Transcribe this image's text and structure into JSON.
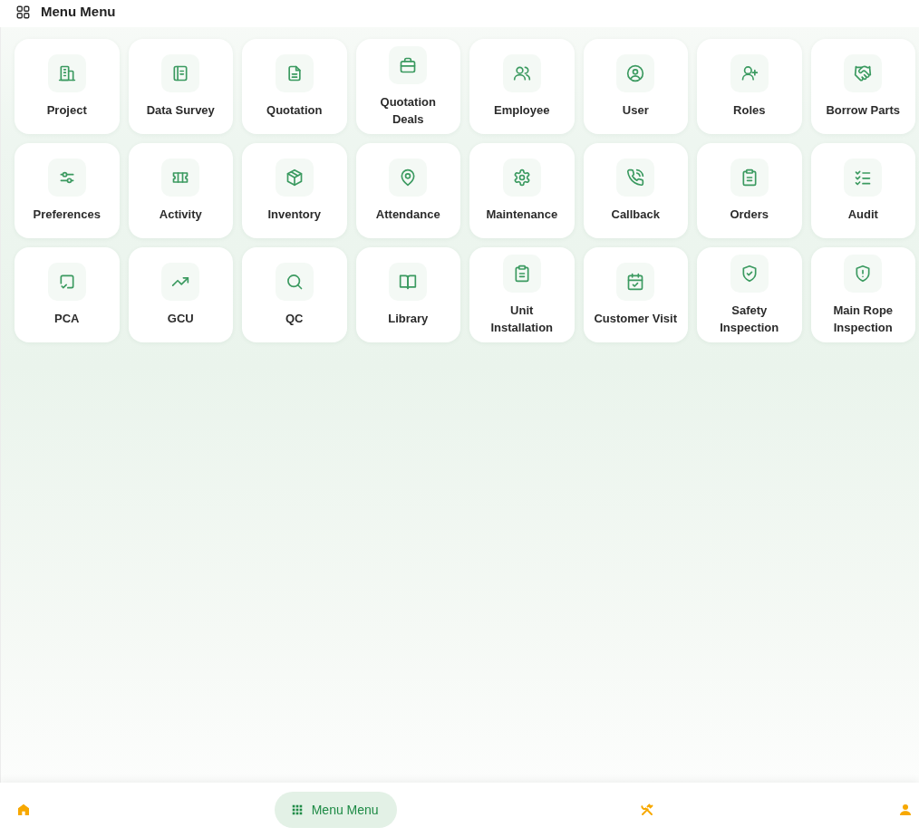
{
  "header": {
    "title": "Menu Menu"
  },
  "menu_items": [
    {
      "label": "Project",
      "kind": "building"
    },
    {
      "label": "Data Survey",
      "kind": "notebook"
    },
    {
      "label": "Quotation",
      "kind": "document"
    },
    {
      "label": "Quotation Deals",
      "kind": "briefcase"
    },
    {
      "label": "Employee",
      "kind": "people"
    },
    {
      "label": "User",
      "kind": "user_circle"
    },
    {
      "label": "Roles",
      "kind": "user_plus"
    },
    {
      "label": "Borrow Parts",
      "kind": "handshake"
    },
    {
      "label": "Preferences",
      "kind": "sliders"
    },
    {
      "label": "Activity",
      "kind": "ticket"
    },
    {
      "label": "Inventory",
      "kind": "package"
    },
    {
      "label": "Attendance",
      "kind": "map_pin"
    },
    {
      "label": "Maintenance",
      "kind": "gear"
    },
    {
      "label": "Callback",
      "kind": "phone_call"
    },
    {
      "label": "Orders",
      "kind": "clipboard"
    },
    {
      "label": "Audit",
      "kind": "checklist"
    },
    {
      "label": "PCA",
      "kind": "square_check"
    },
    {
      "label": "GCU",
      "kind": "trending_up"
    },
    {
      "label": "QC",
      "kind": "search"
    },
    {
      "label": "Library",
      "kind": "book"
    },
    {
      "label": "Unit Installation",
      "kind": "clipboard"
    },
    {
      "label": "Customer Visit",
      "kind": "calendar_check"
    },
    {
      "label": "Safety Inspection",
      "kind": "shield_check"
    },
    {
      "label": "Main Rope Inspection",
      "kind": "shield_alert"
    }
  ],
  "nav": {
    "items": [
      {
        "kind": "home",
        "selected": false
      },
      {
        "kind": "menu",
        "label": "Menu Menu",
        "selected": true
      },
      {
        "kind": "tools",
        "selected": false
      },
      {
        "kind": "person",
        "selected": false
      }
    ]
  }
}
